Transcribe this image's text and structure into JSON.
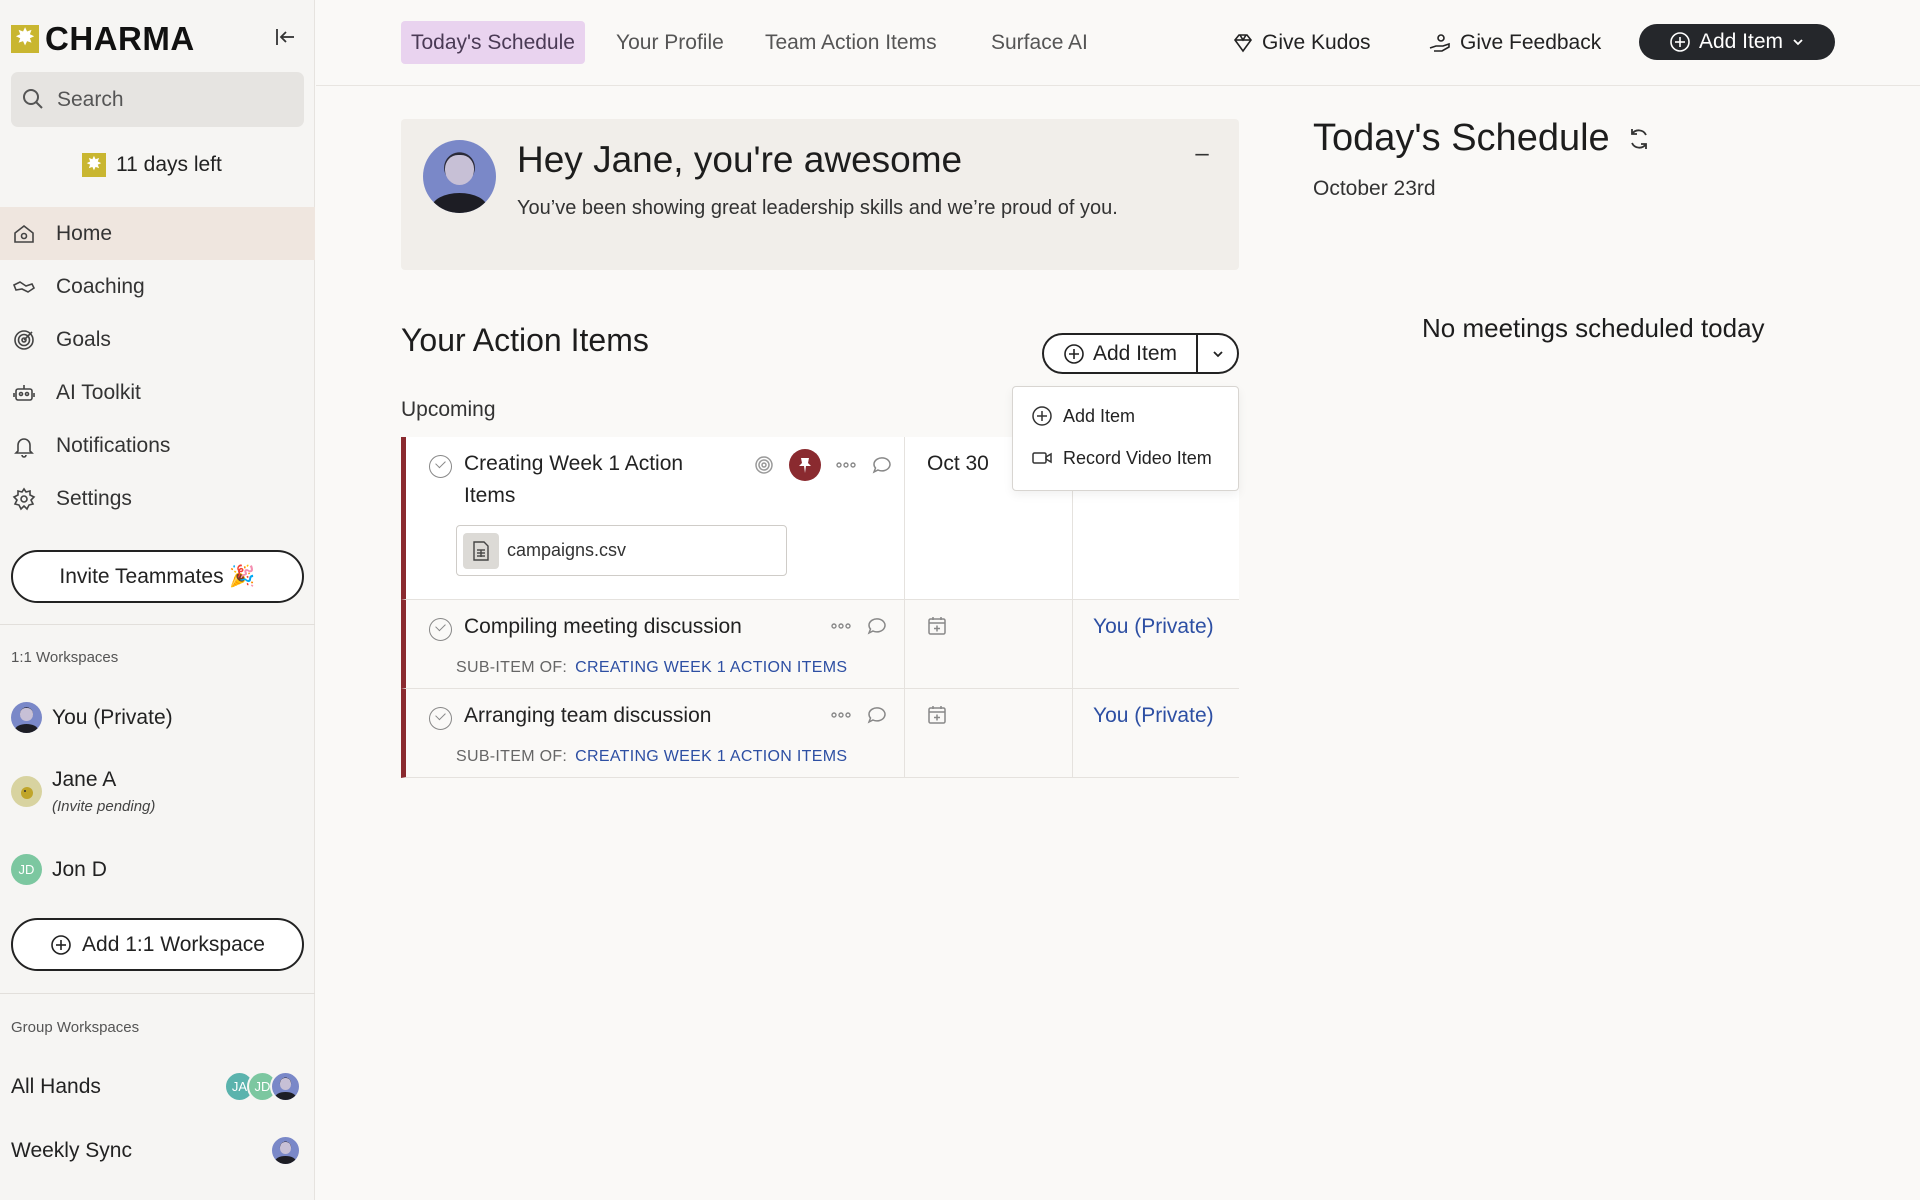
{
  "app": {
    "logo": "CHARMA"
  },
  "sidebar": {
    "search_placeholder": "Search",
    "trial": "11 days left",
    "nav": [
      {
        "label": "Home",
        "icon": "home-icon"
      },
      {
        "label": "Coaching",
        "icon": "coaching-icon"
      },
      {
        "label": "Goals",
        "icon": "goals-icon"
      },
      {
        "label": "AI Toolkit",
        "icon": "robot-icon"
      },
      {
        "label": "Notifications",
        "icon": "bell-icon"
      },
      {
        "label": "Settings",
        "icon": "gear-icon"
      }
    ],
    "invite_label": "Invite Teammates 🎉",
    "one_on_one_label": "1:1 Workspaces",
    "workspaces": [
      {
        "name": "You (Private)"
      },
      {
        "name": "Jane A",
        "sub": "(Invite pending)"
      },
      {
        "name": "Jon D",
        "initials": "JD"
      }
    ],
    "add_workspace_label": "Add 1:1 Workspace",
    "group_label": "Group Workspaces",
    "groups": [
      {
        "name": "All Hands",
        "initials": [
          "JA",
          "JD"
        ]
      },
      {
        "name": "Weekly Sync"
      }
    ]
  },
  "topbar": {
    "tabs": [
      "Today's Schedule",
      "Your Profile",
      "Team Action Items",
      "Surface AI"
    ],
    "active_tab": "Today's Schedule",
    "kudos": "Give Kudos",
    "feedback": "Give Feedback",
    "add_item": "Add Item"
  },
  "kudos_card": {
    "title": "Hey Jane, you're awesome",
    "message": "You’ve been showing great leadership skills and we’re proud of you.",
    "minimize": "–"
  },
  "action_items": {
    "title": "Your Action Items",
    "add_label": "Add Item",
    "section": "Upcoming",
    "sub_of_label": "SUB-ITEM OF:",
    "rows": [
      {
        "title": "Creating Week 1 Action Items",
        "due": "Oct 30",
        "attachment": "campaigns.csv",
        "pinned": true
      },
      {
        "title": "Compiling meeting discussion",
        "parent": "CREATING WEEK 1 ACTION ITEMS",
        "owner": "You (Private)"
      },
      {
        "title": "Arranging team discussion",
        "parent": "CREATING WEEK 1 ACTION ITEMS",
        "owner": "You (Private)"
      }
    ],
    "dropdown": [
      "Add Item",
      "Record Video Item"
    ]
  },
  "schedule": {
    "title": "Today's Schedule",
    "date": "October 23rd",
    "empty": "No meetings scheduled today"
  },
  "colors": {
    "accent_tab": "#e9d3ef",
    "row_border": "#8a2a2f",
    "link": "#2d4fa3",
    "dark_button": "#25272b"
  }
}
